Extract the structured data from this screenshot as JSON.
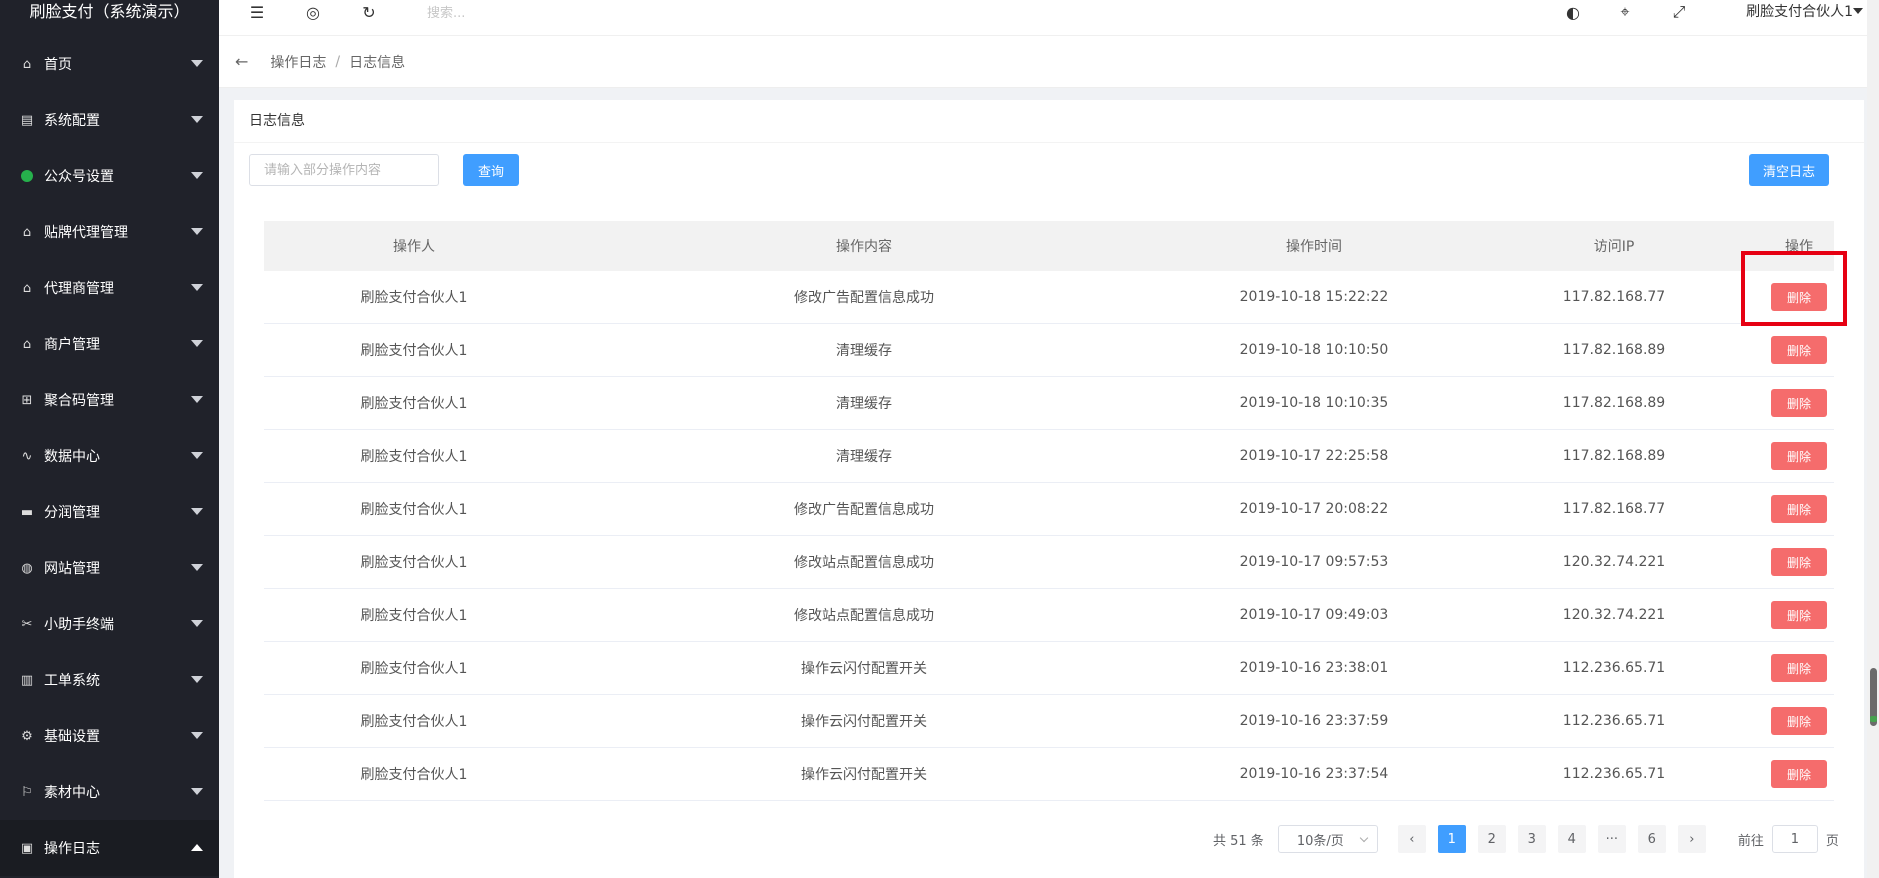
{
  "app": {
    "title": "刷脸支付（系统演示）"
  },
  "sidebar": {
    "items": [
      {
        "label": "首页",
        "icon": "home-icon"
      },
      {
        "label": "系统配置",
        "icon": "settings-grid-icon"
      },
      {
        "label": "公众号设置",
        "icon": "wechat-icon"
      },
      {
        "label": "贴牌代理管理",
        "icon": "home-icon"
      },
      {
        "label": "代理商管理",
        "icon": "home-icon"
      },
      {
        "label": "商户管理",
        "icon": "home-icon"
      },
      {
        "label": "聚合码管理",
        "icon": "qrcode-icon"
      },
      {
        "label": "数据中心",
        "icon": "chart-icon"
      },
      {
        "label": "分润管理",
        "icon": "monitor-icon"
      },
      {
        "label": "网站管理",
        "icon": "globe-icon"
      },
      {
        "label": "小助手终端",
        "icon": "tools-icon"
      },
      {
        "label": "工单系统",
        "icon": "ticket-icon"
      },
      {
        "label": "基础设置",
        "icon": "gear-icon"
      },
      {
        "label": "素材中心",
        "icon": "flag-icon"
      },
      {
        "label": "操作日志",
        "icon": "log-icon"
      }
    ]
  },
  "header": {
    "search_placeholder": "搜索...",
    "user_name": "刷脸支付合伙人1"
  },
  "breadcrumb": {
    "parent": "操作日志",
    "current": "日志信息"
  },
  "card": {
    "title": "日志信息",
    "search_placeholder": "请输入部分操作内容",
    "query_button": "查询",
    "clear_button": "清空日志"
  },
  "table": {
    "headers": {
      "operator": "操作人",
      "content": "操作内容",
      "time": "操作时间",
      "ip": "访问IP",
      "action": "操作"
    },
    "delete_label": "删除",
    "rows": [
      {
        "operator": "刷脸支付合伙人1",
        "content": "修改广告配置信息成功",
        "time": "2019-10-18 15:22:22",
        "ip": "117.82.168.77"
      },
      {
        "operator": "刷脸支付合伙人1",
        "content": "清理缓存",
        "time": "2019-10-18 10:10:50",
        "ip": "117.82.168.89"
      },
      {
        "operator": "刷脸支付合伙人1",
        "content": "清理缓存",
        "time": "2019-10-18 10:10:35",
        "ip": "117.82.168.89"
      },
      {
        "operator": "刷脸支付合伙人1",
        "content": "清理缓存",
        "time": "2019-10-17 22:25:58",
        "ip": "117.82.168.89"
      },
      {
        "operator": "刷脸支付合伙人1",
        "content": "修改广告配置信息成功",
        "time": "2019-10-17 20:08:22",
        "ip": "117.82.168.77"
      },
      {
        "operator": "刷脸支付合伙人1",
        "content": "修改站点配置信息成功",
        "time": "2019-10-17 09:57:53",
        "ip": "120.32.74.221"
      },
      {
        "operator": "刷脸支付合伙人1",
        "content": "修改站点配置信息成功",
        "time": "2019-10-17 09:49:03",
        "ip": "120.32.74.221"
      },
      {
        "operator": "刷脸支付合伙人1",
        "content": "操作云闪付配置开关",
        "time": "2019-10-16 23:38:01",
        "ip": "112.236.65.71"
      },
      {
        "operator": "刷脸支付合伙人1",
        "content": "操作云闪付配置开关",
        "time": "2019-10-16 23:37:59",
        "ip": "112.236.65.71"
      },
      {
        "operator": "刷脸支付合伙人1",
        "content": "操作云闪付配置开关",
        "time": "2019-10-16 23:37:54",
        "ip": "112.236.65.71"
      }
    ]
  },
  "pagination": {
    "total_text": "共 51 条",
    "page_size": "10条/页",
    "prev": "‹",
    "next": "›",
    "pages": [
      "1",
      "2",
      "3",
      "4",
      "···",
      "6"
    ],
    "goto_label": "前往",
    "goto_value": "1",
    "page_unit": "页"
  }
}
